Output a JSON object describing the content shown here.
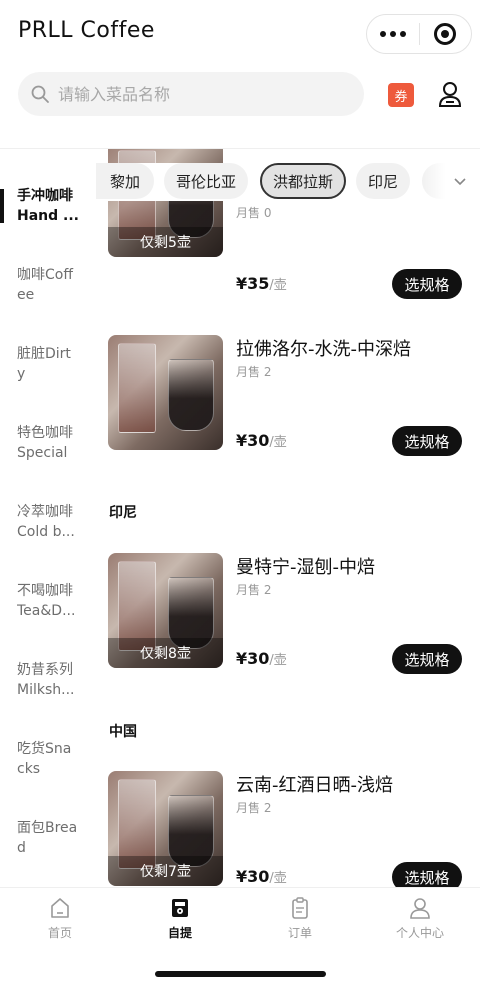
{
  "header": {
    "title": "PRLL Coffee",
    "more_icon": "more-dots-icon",
    "target_icon": "target-icon"
  },
  "search": {
    "placeholder": "请输入菜品名称",
    "icon": "search-icon"
  },
  "coupon_label": "券",
  "sidebar": {
    "items": [
      {
        "line1": "手冲咖啡",
        "line2": "Hand ..."
      },
      {
        "line1": "咖啡Coff",
        "line2": "ee"
      },
      {
        "line1": "脏脏Dirt",
        "line2": "y"
      },
      {
        "line1": "特色咖啡",
        "line2": "Special"
      },
      {
        "line1": "冷萃咖啡",
        "line2": "Cold b..."
      },
      {
        "line1": "不喝咖啡",
        "line2": "Tea&D..."
      },
      {
        "line1": "奶昔系列",
        "line2": "Milksh..."
      },
      {
        "line1": "吃货Sna",
        "line2": "cks"
      },
      {
        "line1": "面包Brea",
        "line2": "d"
      }
    ]
  },
  "chips": [
    "黎加",
    "哥伦比亚",
    "洪都拉斯",
    "印尼"
  ],
  "products": [
    {
      "name": "",
      "sold": "月售 0",
      "price": "¥35",
      "unit": "/壶",
      "stock": "仅剩5壶",
      "button": "选规格"
    },
    {
      "name": "拉佛洛尔-水洗-中深焙",
      "sold": "月售 2",
      "price": "¥30",
      "unit": "/壶",
      "stock": "",
      "button": "选规格"
    },
    {
      "name": "曼特宁-湿刨-中焙",
      "sold": "月售 2",
      "price": "¥30",
      "unit": "/壶",
      "stock": "仅剩8壶",
      "button": "选规格"
    },
    {
      "name": "云南-红酒日晒-浅焙",
      "sold": "月售 2",
      "price": "¥30",
      "unit": "/壶",
      "stock": "仅剩7壶",
      "button": "选规格"
    }
  ],
  "sections": [
    "印尼",
    "中国"
  ],
  "tabbar": {
    "items": [
      {
        "label": "首页",
        "icon": "home-icon"
      },
      {
        "label": "自提",
        "icon": "pickup-icon"
      },
      {
        "label": "订单",
        "icon": "order-icon"
      },
      {
        "label": "个人中心",
        "icon": "profile-icon"
      }
    ]
  },
  "colors": {
    "accent": "#111111",
    "coupon": "#ee5a3c"
  }
}
